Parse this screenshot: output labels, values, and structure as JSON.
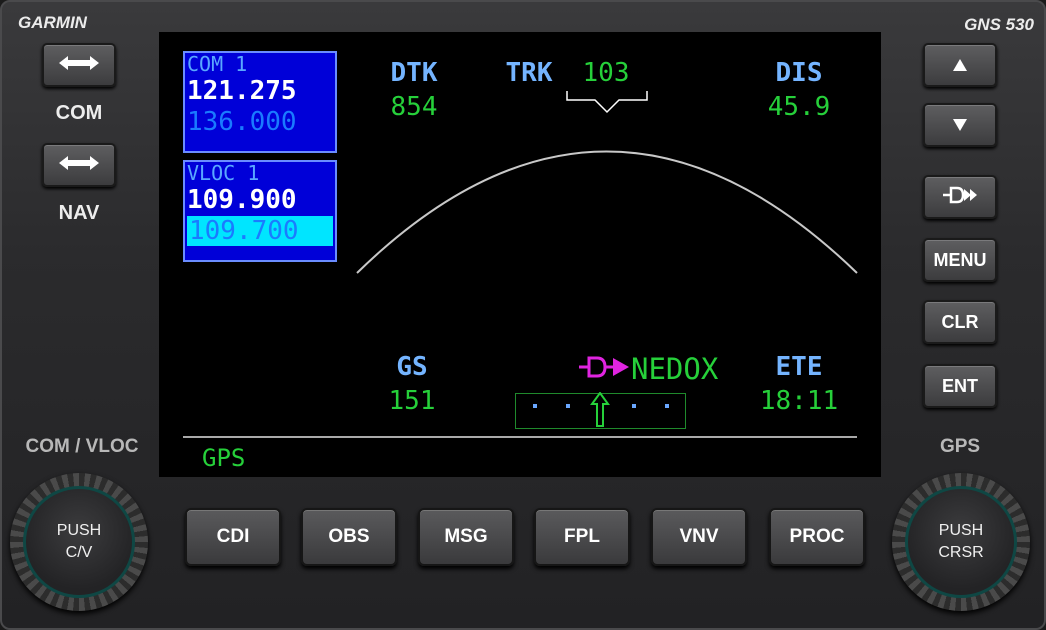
{
  "brand": {
    "left": "GARMIN",
    "right": "GNS 530"
  },
  "left_panel": {
    "com_swap_icon": "⬌",
    "com_label": "COM",
    "nav_swap_icon": "⬌",
    "nav_label": "NAV",
    "knob_label": "COM / VLOC",
    "knob_push_line1": "PUSH",
    "knob_push_line2": "C/V"
  },
  "right_panel": {
    "up_icon": "▲",
    "down_icon": "▼",
    "direct_to": "-D»",
    "menu": "MENU",
    "clr": "CLR",
    "ent": "ENT",
    "knob_label": "GPS",
    "knob_push_line1": "PUSH",
    "knob_push_line2": "CRSR"
  },
  "screen": {
    "com": {
      "label": "COM 1",
      "active": "121.275",
      "standby": "136.000"
    },
    "vloc": {
      "label": "VLOC 1",
      "active": "109.900",
      "standby": "109.700"
    },
    "dtk": {
      "label": "DTK",
      "value": "854"
    },
    "trk": {
      "label": "TRK",
      "value": "103"
    },
    "dis": {
      "label": "DIS",
      "value": "45.9"
    },
    "gs": {
      "label": "GS",
      "value": "151"
    },
    "ete": {
      "label": "ETE",
      "value": "18:11"
    },
    "destination": {
      "symbol": "-D▶",
      "waypoint": "NEDOX"
    },
    "mode": "GPS"
  },
  "softkeys": [
    "CDI",
    "OBS",
    "MSG",
    "FPL",
    "VNV",
    "PROC"
  ],
  "colors": {
    "active_freq_box": "#0000d8",
    "standby_highlight": "#00e5ff",
    "field_label": "#74b4ff",
    "field_value": "#26d03a",
    "direct_to_magenta": "#e024e0"
  }
}
